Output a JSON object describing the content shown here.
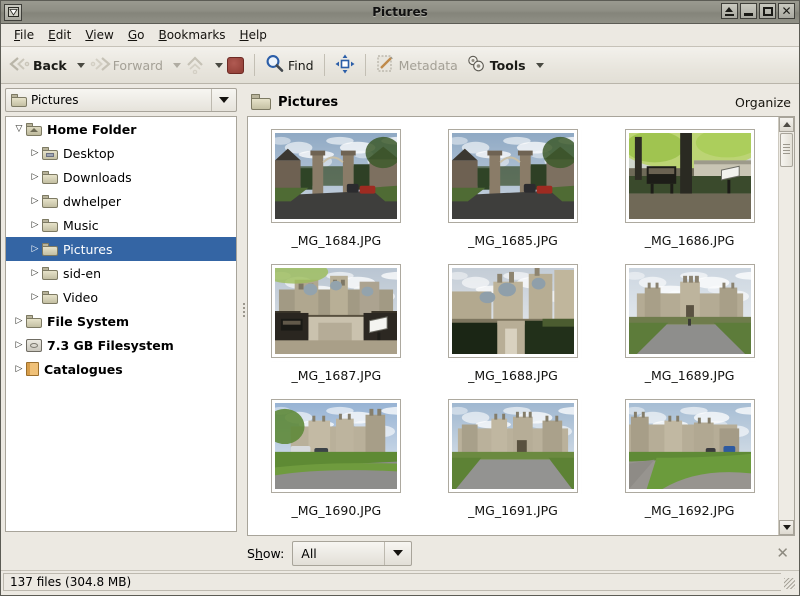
{
  "window": {
    "title": "Pictures",
    "menu_button_icon": "window-menu-icon",
    "buttons": [
      {
        "name": "shade",
        "icon": "shade-icon",
        "label": "▲"
      },
      {
        "name": "minimize",
        "icon": "minimize-icon",
        "label": "_"
      },
      {
        "name": "maximize",
        "icon": "maximize-icon",
        "label": "□"
      },
      {
        "name": "close",
        "icon": "close-icon",
        "label": "✕"
      }
    ]
  },
  "menubar": [
    {
      "label": "File",
      "mnemonic": "F"
    },
    {
      "label": "Edit",
      "mnemonic": "E"
    },
    {
      "label": "View",
      "mnemonic": "V"
    },
    {
      "label": "Go",
      "mnemonic": "G"
    },
    {
      "label": "Bookmarks",
      "mnemonic": "B"
    },
    {
      "label": "Help",
      "mnemonic": "H"
    }
  ],
  "toolbar": {
    "back_label": "Back",
    "forward_label": "Forward",
    "stop_label": "",
    "find_label": "Find",
    "metadata_label": "Metadata",
    "tools_label": "Tools"
  },
  "sidebar": {
    "path_combo_value": "Pictures",
    "tree": [
      {
        "label": "Home Folder",
        "level": 0,
        "bold": true,
        "twisty": "open",
        "icon": "home-folder-icon",
        "selected": false
      },
      {
        "label": "Desktop",
        "level": 1,
        "bold": false,
        "twisty": "closed",
        "icon": "desktop-folder-icon",
        "selected": false
      },
      {
        "label": "Downloads",
        "level": 1,
        "bold": false,
        "twisty": "closed",
        "icon": "folder-icon",
        "selected": false
      },
      {
        "label": "dwhelper",
        "level": 1,
        "bold": false,
        "twisty": "closed",
        "icon": "folder-icon",
        "selected": false
      },
      {
        "label": "Music",
        "level": 1,
        "bold": false,
        "twisty": "closed",
        "icon": "folder-icon",
        "selected": false
      },
      {
        "label": "Pictures",
        "level": 1,
        "bold": false,
        "twisty": "closed",
        "icon": "folder-icon",
        "selected": true
      },
      {
        "label": "sid-en",
        "level": 1,
        "bold": false,
        "twisty": "closed",
        "icon": "folder-icon",
        "selected": false
      },
      {
        "label": "Video",
        "level": 1,
        "bold": false,
        "twisty": "closed",
        "icon": "folder-icon",
        "selected": false
      },
      {
        "label": "File System",
        "level": 0,
        "bold": true,
        "twisty": "closed",
        "icon": "folder-icon",
        "selected": false
      },
      {
        "label": "7.3 GB Filesystem",
        "level": 0,
        "bold": true,
        "twisty": "closed",
        "icon": "disk-icon",
        "selected": false
      },
      {
        "label": "Catalogues",
        "level": 0,
        "bold": true,
        "twisty": "closed",
        "icon": "book-icon",
        "selected": false
      }
    ]
  },
  "content": {
    "title": "Pictures",
    "organize_label": "Organize",
    "files": [
      {
        "name": "_MG_1684.JPG",
        "scene": "gates"
      },
      {
        "name": "_MG_1685.JPG",
        "scene": "gates"
      },
      {
        "name": "_MG_1686.JPG",
        "scene": "tree-sign"
      },
      {
        "name": "_MG_1687.JPG",
        "scene": "castle-wall"
      },
      {
        "name": "_MG_1688.JPG",
        "scene": "castle-hedge"
      },
      {
        "name": "_MG_1689.JPG",
        "scene": "castle-drive"
      },
      {
        "name": "_MG_1690.JPG",
        "scene": "castle-lawn"
      },
      {
        "name": "_MG_1691.JPG",
        "scene": "castle-front"
      },
      {
        "name": "_MG_1692.JPG",
        "scene": "castle-angle"
      }
    ]
  },
  "footer": {
    "show_label": "Show:",
    "show_mnemonic": "h",
    "show_value": "All",
    "close_label": "✕"
  },
  "statusbar": {
    "text": "137 files (304.8 MB)"
  },
  "colors": {
    "selection": "#3465a4",
    "window_bg": "#ece9e2",
    "titlebar": "#8e8e84"
  }
}
